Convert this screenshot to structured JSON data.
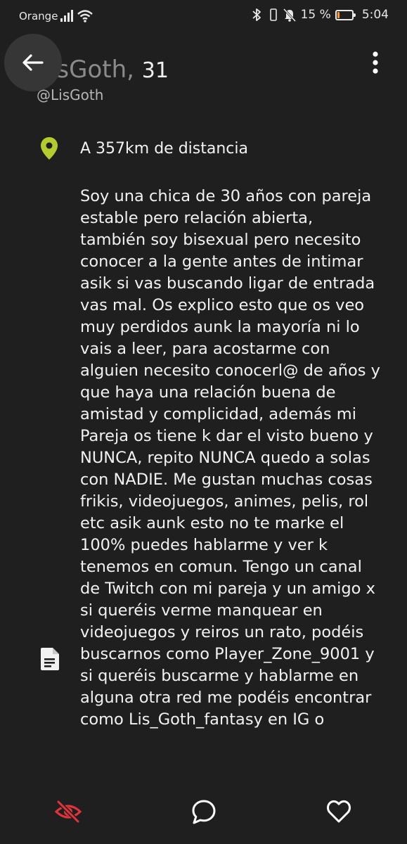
{
  "status_bar": {
    "carrier": "Orange",
    "battery_percent_label": "15 %",
    "battery_level": 0.15,
    "time": "5:04"
  },
  "profile": {
    "name": "LisGoth",
    "separator": ",",
    "age": "31",
    "username": "@LisGoth",
    "distance": "A 357km de distancia",
    "bio": "Soy una chica de 30 años con pareja estable pero relación abierta, también soy bisexual pero necesito conocer a la gente antes de intimar asik si vas buscando ligar de entrada vas mal. Os explico esto que os veo muy perdidos aunk la mayoría ni lo vais a leer, para acostarme con alguien necesito conocerl@ de años y que haya una relación buena de amistad y complicidad, además mi Pareja os tiene k dar el visto bueno y NUNCA, repito NUNCA quedo a solas con NADIE. Me gustan muchas cosas frikis, videojuegos, animes, pelis, rol etc asik aunk esto no te marke el 100% puedes hablarme y ver k tenemos en comun. Tengo un canal de Twitch con mi pareja y un amigo x si queréis verme manquear en videojuegos y reiros un rato, podéis buscarnos como Player_Zone_9001 y si queréis buscarme y hablarme en alguna otra red me podéis encontrar como Lis_Goth_fantasy en IG o"
  },
  "icons": {
    "back": "arrow-left-icon",
    "more": "more-vertical-icon",
    "location": "map-pin-icon",
    "bio": "document-icon",
    "hide": "eye-off-icon",
    "chat": "chat-bubble-icon",
    "like": "heart-icon"
  },
  "colors": {
    "background": "#1f1f1f",
    "accent_location": "#b5cc2e",
    "hide_red": "#e0343a",
    "battery_orange": "#ff9a1a"
  }
}
